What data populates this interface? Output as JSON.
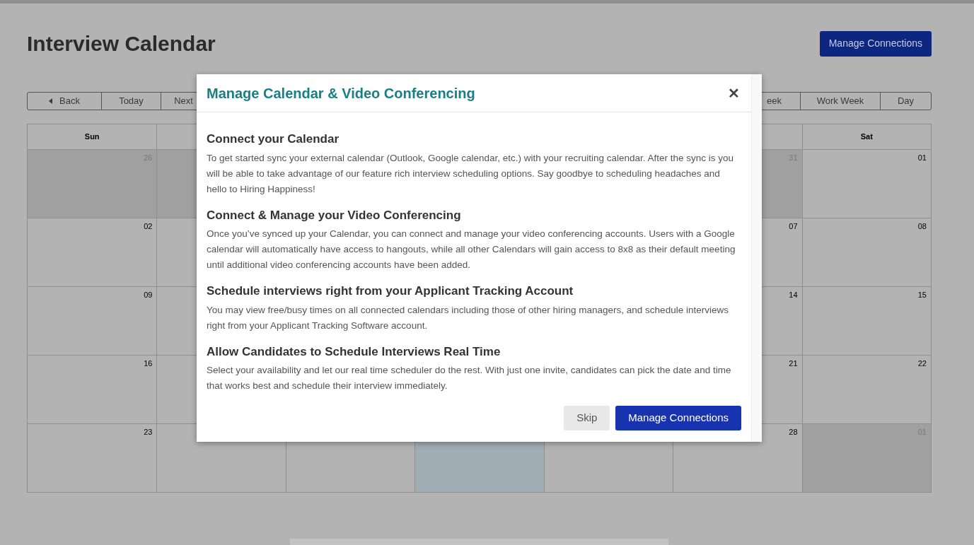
{
  "page": {
    "title": "Interview Calendar",
    "header_button": "Manage Connections"
  },
  "toolbar": {
    "left": [
      "Back",
      "Today",
      "Next"
    ],
    "right": [
      "eek",
      "Work Week",
      "Day"
    ]
  },
  "calendar": {
    "first_header": "Sun",
    "last_header": "Sat",
    "weeks": [
      {
        "cells": [
          {
            "day": "26",
            "other_month": true,
            "today": false
          },
          {
            "other_month": true,
            "today": false
          },
          null,
          null,
          null,
          {
            "day": "31",
            "other_month": true,
            "today": false
          },
          {
            "day": "01",
            "other_month": false,
            "today": false
          }
        ]
      },
      {
        "cells": [
          {
            "day": "02",
            "other_month": false,
            "today": false
          },
          {
            "other_month": false,
            "today": false
          },
          null,
          null,
          null,
          {
            "day": "07",
            "other_month": false,
            "today": false
          },
          {
            "day": "08",
            "other_month": false,
            "today": false
          }
        ]
      },
      {
        "cells": [
          {
            "day": "09",
            "other_month": false,
            "today": false
          },
          {
            "other_month": false,
            "today": false
          },
          null,
          null,
          null,
          {
            "day": "14",
            "other_month": false,
            "today": false
          },
          {
            "day": "15",
            "other_month": false,
            "today": false
          }
        ]
      },
      {
        "cells": [
          {
            "day": "16",
            "other_month": false,
            "today": false
          },
          {
            "other_month": false,
            "today": false
          },
          null,
          null,
          null,
          {
            "day": "21",
            "other_month": false,
            "today": false
          },
          {
            "day": "22",
            "other_month": false,
            "today": false
          }
        ]
      },
      {
        "cells": [
          {
            "day": "23",
            "other_month": false,
            "today": false
          },
          {
            "other_month": false,
            "today": false
          },
          {
            "other_month": false,
            "today": false
          },
          {
            "today": true
          },
          {
            "other_month": false,
            "today": false
          },
          {
            "day": "28",
            "other_month": false,
            "today": false
          },
          {
            "day": "01",
            "other_month": true,
            "today": false
          }
        ]
      }
    ]
  },
  "dialog": {
    "title": "Manage Calendar & Video Conferencing",
    "close": "✕",
    "sections": [
      {
        "heading": "Connect your Calendar",
        "text": "To get started sync your external calendar (Outlook, Google calendar, etc.) with your recruiting calendar. After the sync is you will be able to take advantage of our feature rich interview scheduling options. Say goodbye to scheduling headaches and hello to Hiring Happiness!"
      },
      {
        "heading": "Connect & Manage your Video Conferencing",
        "text": "Once you’ve synced up your Calendar, you can connect and manage your video conferencing accounts. Users with a Google calendar will automatically have access to hangouts, while all other Calendars will gain access to 8x8 as their default meeting until additional video conferencing accounts have been added."
      },
      {
        "heading": "Schedule interviews right from your Applicant Tracking Account",
        "text": "You may view free/busy times on all connected calendars including those of other hiring managers, and schedule interviews right from your Applicant Tracking Software account."
      },
      {
        "heading": "Allow Candidates to Schedule Interviews Real Time",
        "text": "Select your availability and let our real time scheduler do the rest. With just one invite, candidates can pick the date and time that works best and schedule their interview immediately."
      }
    ],
    "buttons": [
      {
        "label": "Skip",
        "kind": "secondary"
      },
      {
        "label": "Manage Connections",
        "kind": "primary"
      }
    ]
  }
}
